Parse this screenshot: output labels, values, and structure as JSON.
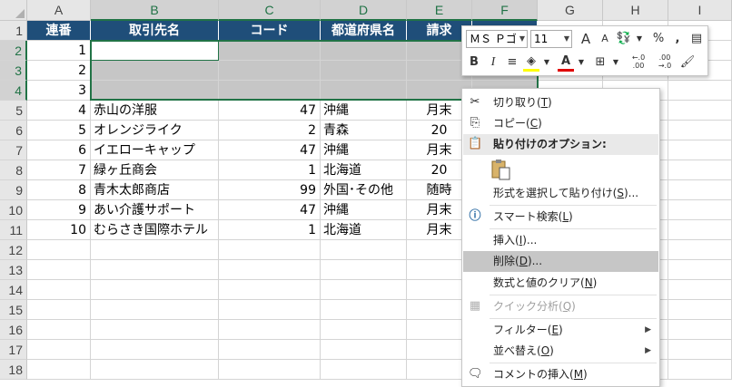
{
  "columns": [
    "A",
    "B",
    "C",
    "D",
    "E",
    "F",
    "G",
    "H",
    "I"
  ],
  "rows": [
    "1",
    "2",
    "3",
    "4",
    "5",
    "6",
    "7",
    "8",
    "9",
    "10",
    "11",
    "12",
    "13",
    "14",
    "15",
    "16",
    "17",
    "18"
  ],
  "table_headers": [
    "連番",
    "取引先名",
    "コード",
    "都道府県名",
    "請求",
    ""
  ],
  "table_rows": [
    [
      "1",
      "",
      "",
      "",
      "",
      ""
    ],
    [
      "2",
      "",
      "",
      "",
      "",
      ""
    ],
    [
      "3",
      "",
      "",
      "",
      "",
      ""
    ],
    [
      "4",
      "赤山の洋服",
      "47",
      "沖縄",
      "月末",
      ""
    ],
    [
      "5",
      "オレンジライク",
      "2",
      "青森",
      "20",
      ""
    ],
    [
      "6",
      "イエローキャップ",
      "47",
      "沖縄",
      "月末",
      ""
    ],
    [
      "7",
      "緑ヶ丘商会",
      "1",
      "北海道",
      "20",
      ""
    ],
    [
      "8",
      "青木太郎商店",
      "99",
      "外国･その他",
      "随時",
      ""
    ],
    [
      "9",
      "あい介護サポート",
      "47",
      "沖縄",
      "月末",
      ""
    ],
    [
      "10",
      "むらさき国際ホテル",
      "1",
      "北海道",
      "月末",
      ""
    ]
  ],
  "mini_toolbar": {
    "font_name": "ＭＳ Ｐゴ",
    "font_size": "11",
    "grow_font": "A",
    "shrink_font": "A",
    "percent": "%",
    "comma": ",",
    "bold": "B",
    "italic": "I",
    "font_color": "A",
    "dec_increase": "←.0 .00",
    "dec_decrease": ".00 →.0"
  },
  "context_menu": {
    "cut": {
      "label": "切り取り(",
      "key": "T",
      "tail": ")"
    },
    "copy": {
      "label": "コピー(",
      "key": "C",
      "tail": ")"
    },
    "paste_options": "貼り付けのオプション:",
    "paste_special": {
      "label": "形式を選択して貼り付け(",
      "key": "S",
      "tail": ")..."
    },
    "smart_lookup": {
      "label": "スマート検索(",
      "key": "L",
      "tail": ")"
    },
    "insert": {
      "label": "挿入(",
      "key": "I",
      "tail": ")..."
    },
    "delete": {
      "label": "削除(",
      "key": "D",
      "tail": ")..."
    },
    "clear_contents": {
      "label": "数式と値のクリア(",
      "key": "N",
      "tail": ")"
    },
    "quick_analysis": {
      "label": "クイック分析(",
      "key": "Q",
      "tail": ")"
    },
    "filter": {
      "label": "フィルター(",
      "key": "E",
      "tail": ")"
    },
    "sort": {
      "label": "並べ替え(",
      "key": "O",
      "tail": ")"
    },
    "insert_comment": {
      "label": "コメントの挿入(",
      "key": "M",
      "tail": ")"
    }
  },
  "colors": {
    "header_bg": "#1f4e79",
    "selection": "#217346",
    "gray": "#c6c6c6"
  }
}
